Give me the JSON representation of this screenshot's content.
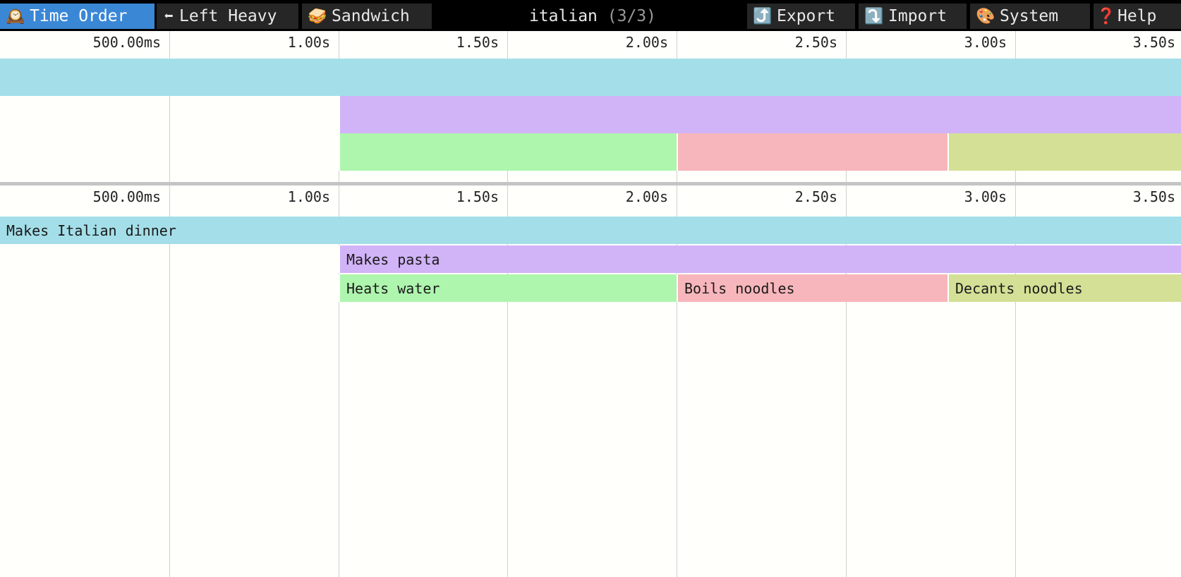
{
  "toolbar": {
    "time_order": {
      "icon": "🕰️",
      "icon_name": "mantelpiece-clock-icon",
      "label": "Time Order"
    },
    "left_heavy": {
      "icon": "⬅",
      "icon_name": "left-arrow-icon",
      "label": "Left Heavy"
    },
    "sandwich": {
      "icon": "🥪",
      "icon_name": "sandwich-icon",
      "label": "Sandwich"
    },
    "title": "italian",
    "title_count": "(3/3)",
    "export": {
      "icon": "⤴️",
      "icon_name": "export-arrow-icon",
      "label": "Export"
    },
    "import": {
      "icon": "⤵️",
      "icon_name": "import-arrow-icon",
      "label": "Import"
    },
    "system": {
      "icon": "🎨",
      "icon_name": "palette-icon",
      "label": "System"
    },
    "help": {
      "icon": "❓",
      "icon_name": "question-mark-icon",
      "label": "Help"
    }
  },
  "ticks": [
    "500.00ms",
    "1.00s",
    "1.50s",
    "2.00s",
    "2.50s",
    "3.00s",
    "3.50s"
  ],
  "frames": [
    {
      "name": "Makes Italian dinner",
      "start": 0.0,
      "end": 4.0,
      "depth": 0,
      "color": "#a4dfe9"
    },
    {
      "name": "Makes pasta",
      "start": 1.0,
      "end": 4.0,
      "depth": 1,
      "color": "#d1b3f7"
    },
    {
      "name": "Heats water",
      "start": 1.0,
      "end": 2.0,
      "depth": 2,
      "color": "#aef5ae"
    },
    {
      "name": "Boils noodles",
      "start": 2.0,
      "end": 2.8,
      "depth": 2,
      "color": "#f7b6bb"
    },
    {
      "name": "Decants noodles",
      "start": 2.8,
      "end": 4.0,
      "depth": 2,
      "color": "#d3e095"
    }
  ],
  "colors": {
    "toolbar_bg": "#000000",
    "active_tab": "#3a87d6",
    "button_bg": "#262626",
    "canvas_bg": "#fffffb"
  }
}
